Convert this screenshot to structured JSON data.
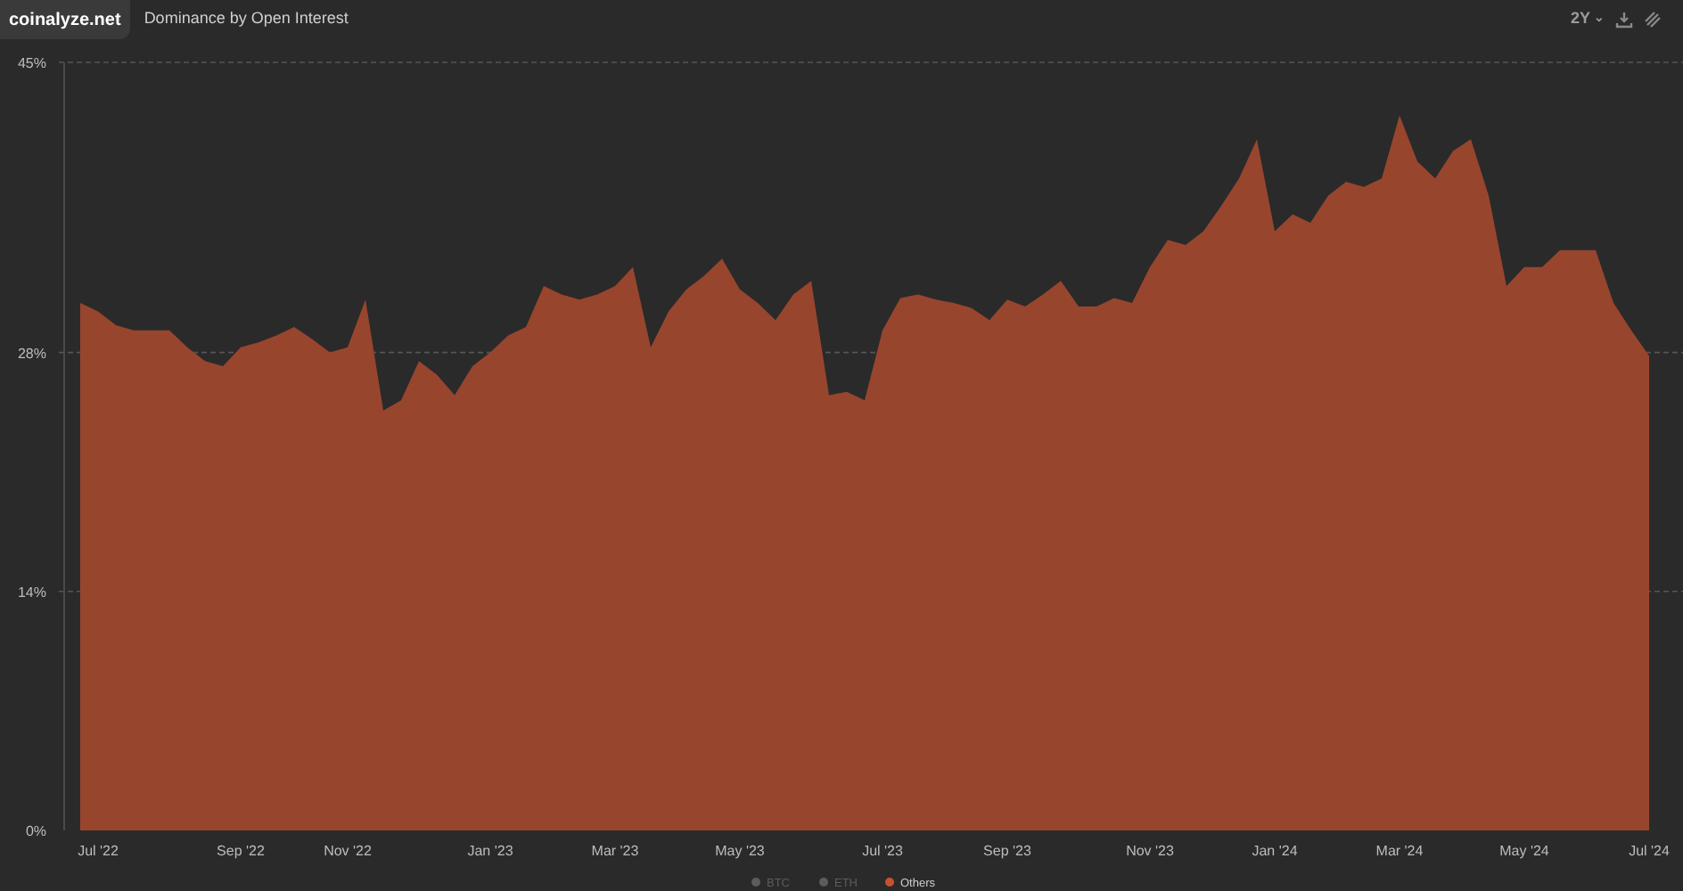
{
  "header": {
    "logo": "coinalyze.net",
    "title": "Dominance by Open Interest"
  },
  "toolbar": {
    "range": "2Y",
    "range_caret": "⌄"
  },
  "chart_data": {
    "type": "area",
    "ylim": [
      0,
      45
    ],
    "categories": [
      null,
      "Jul '22",
      null,
      null,
      null,
      null,
      null,
      null,
      null,
      "Sep '22",
      null,
      null,
      null,
      null,
      null,
      "Nov '22",
      null,
      null,
      null,
      null,
      null,
      null,
      null,
      "Jan '23",
      null,
      null,
      null,
      null,
      null,
      null,
      "Mar '23",
      null,
      null,
      null,
      null,
      null,
      null,
      "May '23",
      null,
      null,
      null,
      null,
      null,
      null,
      null,
      "Jul '23",
      null,
      null,
      null,
      null,
      null,
      null,
      "Sep '23",
      null,
      null,
      null,
      null,
      null,
      null,
      null,
      "Nov '23",
      null,
      null,
      null,
      null,
      null,
      null,
      "Jan '24",
      null,
      null,
      null,
      null,
      null,
      null,
      "Mar '24",
      null,
      null,
      null,
      null,
      null,
      null,
      "May '24",
      null,
      null,
      null,
      null,
      null,
      null,
      "Jul '24"
    ],
    "yticks": [
      {
        "value": 0,
        "label": "0%"
      },
      {
        "value": 14,
        "label": "14%"
      },
      {
        "value": 28,
        "label": "28%"
      },
      {
        "value": 45,
        "label": "45%"
      }
    ],
    "series": [
      {
        "name": "Others",
        "color": "#98452e",
        "values": [
          30.9,
          30.4,
          29.6,
          29.3,
          29.3,
          29.3,
          28.3,
          27.5,
          27.2,
          28.3,
          28.6,
          29.0,
          29.5,
          28.8,
          28.0,
          28.3,
          31.1,
          24.6,
          25.2,
          27.5,
          26.7,
          25.5,
          27.2,
          28.0,
          29.0,
          29.5,
          31.9,
          31.4,
          31.1,
          31.4,
          31.9,
          33.0,
          28.3,
          30.4,
          31.7,
          32.5,
          33.5,
          31.7,
          30.9,
          29.9,
          31.4,
          32.2,
          25.5,
          25.7,
          25.2,
          29.3,
          31.2,
          31.4,
          31.1,
          30.9,
          30.6,
          29.9,
          31.1,
          30.7,
          31.4,
          32.2,
          30.7,
          30.7,
          31.2,
          30.9,
          33.0,
          34.6,
          34.3,
          35.1,
          36.6,
          38.2,
          40.5,
          35.1,
          36.1,
          35.6,
          37.2,
          38.0,
          37.7,
          38.2,
          41.9,
          39.2,
          38.2,
          39.8,
          40.5,
          37.2,
          31.9,
          33.0,
          33.0,
          34.0,
          34.0,
          34.0,
          30.9,
          29.3,
          27.8
        ]
      }
    ]
  },
  "legend": [
    {
      "label": "BTC",
      "visible": false
    },
    {
      "label": "ETH",
      "visible": false
    }
  ]
}
